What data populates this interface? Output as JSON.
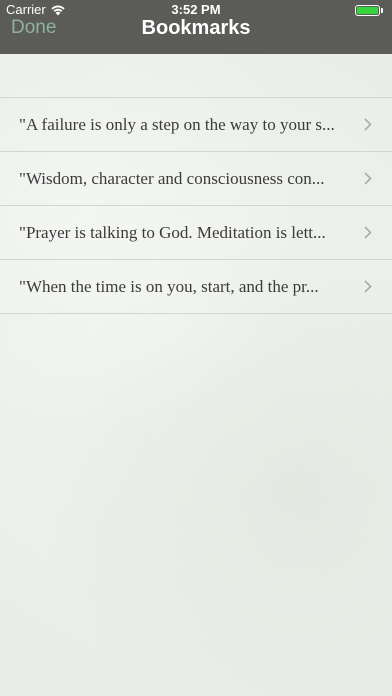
{
  "status_bar": {
    "carrier": "Carrier",
    "time": "3:52 PM",
    "wifi_icon": "wifi-icon",
    "battery_icon": "battery-icon",
    "battery_color": "#36d33d"
  },
  "nav": {
    "done_label": "Done",
    "title": "Bookmarks",
    "done_color": "#8fb39a",
    "bar_color": "#5b5b58"
  },
  "bookmarks": [
    {
      "text": "\"A failure is only a step on the way to your s...",
      "icon": "chevron-right-icon"
    },
    {
      "text": "\"Wisdom, character and consciousness con...",
      "icon": "chevron-right-icon"
    },
    {
      "text": "\"Prayer is talking to God. Meditation is lett...",
      "icon": "chevron-right-icon"
    },
    {
      "text": "\"When the time is on you, start, and the pr...",
      "icon": "chevron-right-icon"
    }
  ]
}
